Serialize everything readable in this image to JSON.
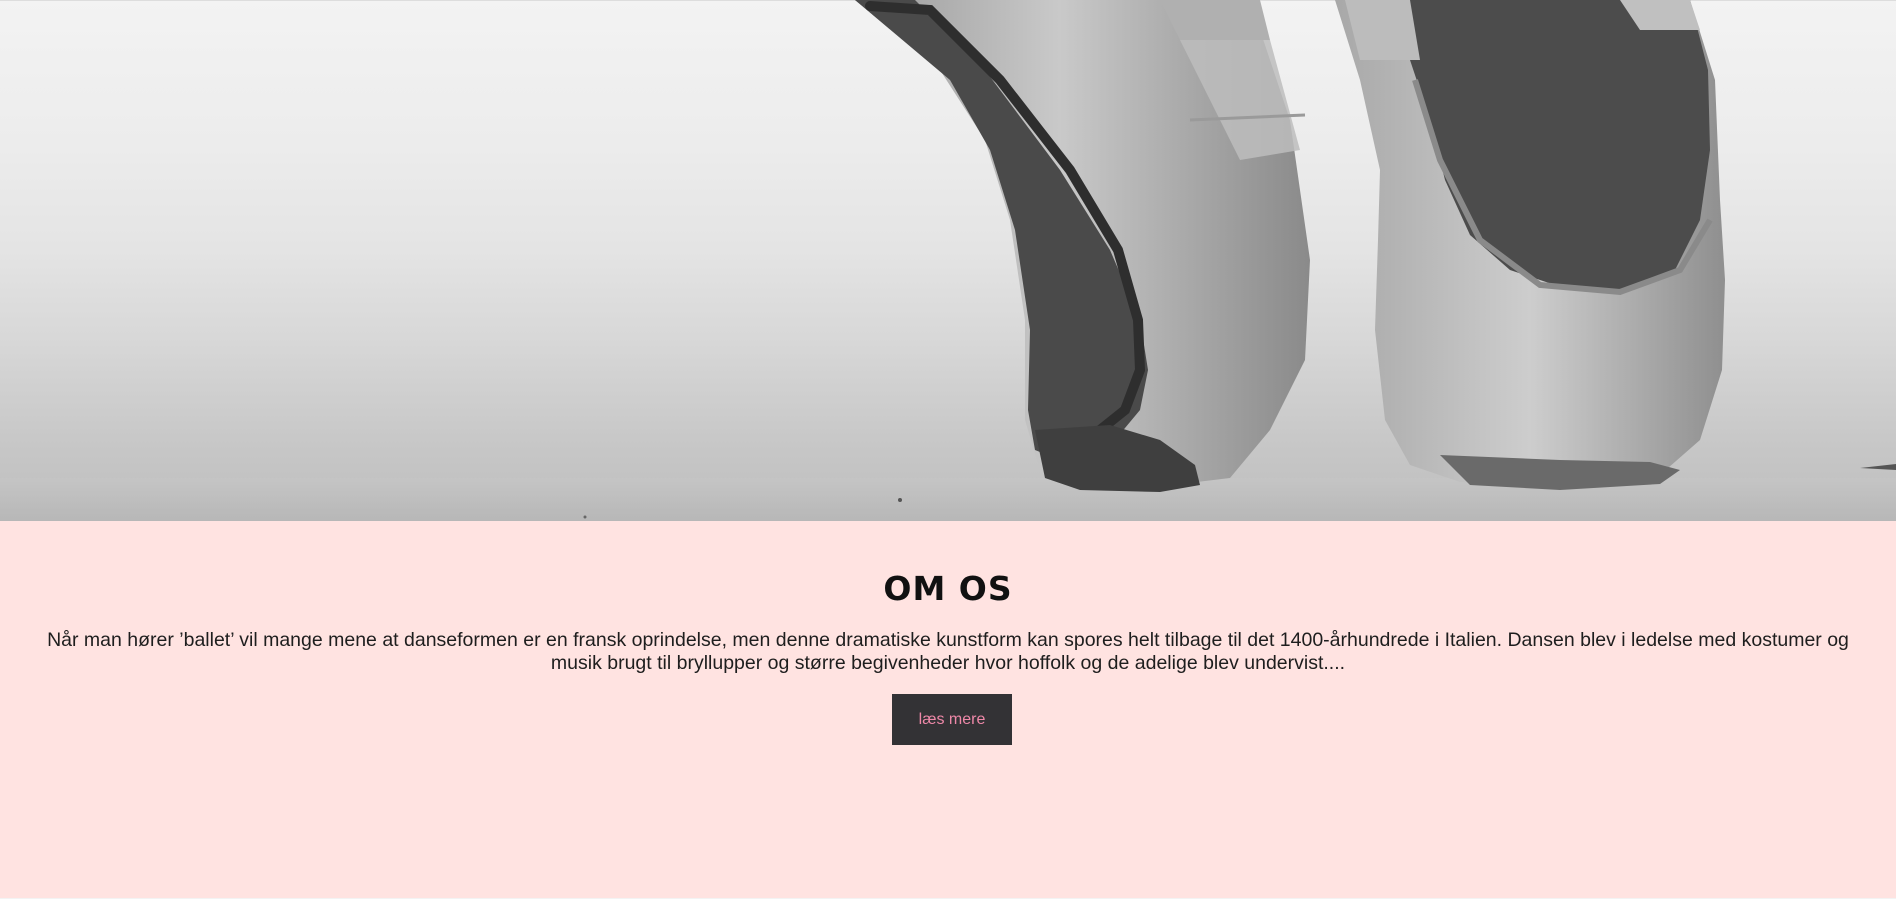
{
  "hero": {
    "image": "ballet-pointe-shoes-photo"
  },
  "about": {
    "title": "OM OS",
    "text": "Når man hører ’ballet’ vil mange mene at danseformen er en fransk oprindelse, men denne dramatiske kunstform kan spores helt tilbage til det 1400-århundrede i Italien. Dansen blev i ledelse med kostumer og musik brugt til bryllupper og større begivenheder hvor hoffolk og de adelige blev undervist....",
    "button_label": "læs mere"
  },
  "colors": {
    "section_background": "#ffe3e1",
    "button_background": "#333235",
    "button_text": "#ee88a8"
  }
}
